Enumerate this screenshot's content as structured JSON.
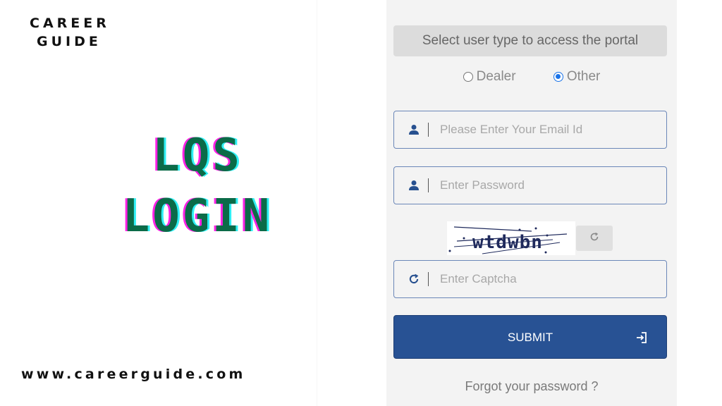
{
  "branding": {
    "line1": "CAREER",
    "line2": "GUIDE",
    "website": "www.careerguide.com"
  },
  "hero": {
    "line1": "LQS",
    "line2": "LOGIN"
  },
  "login_panel": {
    "banner": "Select user type to access the portal",
    "user_types": [
      {
        "label": "Dealer",
        "selected": false
      },
      {
        "label": "Other",
        "selected": true
      }
    ],
    "email": {
      "icon": "user-icon",
      "value": "",
      "placeholder": "Please Enter Your Email Id"
    },
    "password": {
      "icon": "user-icon",
      "value": "",
      "placeholder": "Enter Password"
    },
    "captcha": {
      "text": "wtdwbn",
      "refresh_icon": "refresh-icon"
    },
    "captcha_input": {
      "icon": "refresh-icon",
      "value": "",
      "placeholder": "Enter Captcha"
    },
    "submit": {
      "label": "SUBMIT",
      "icon": "sign-in-icon"
    },
    "forgot_password": "Forgot your password ?"
  },
  "colors": {
    "accent": "#285294",
    "hero_text": "#0b6b48",
    "glitch_magenta": "#ff22e6",
    "glitch_cyan": "#2ff0f5",
    "panel_bg": "#f3f3f3",
    "radio_checked": "#1a73e8"
  }
}
